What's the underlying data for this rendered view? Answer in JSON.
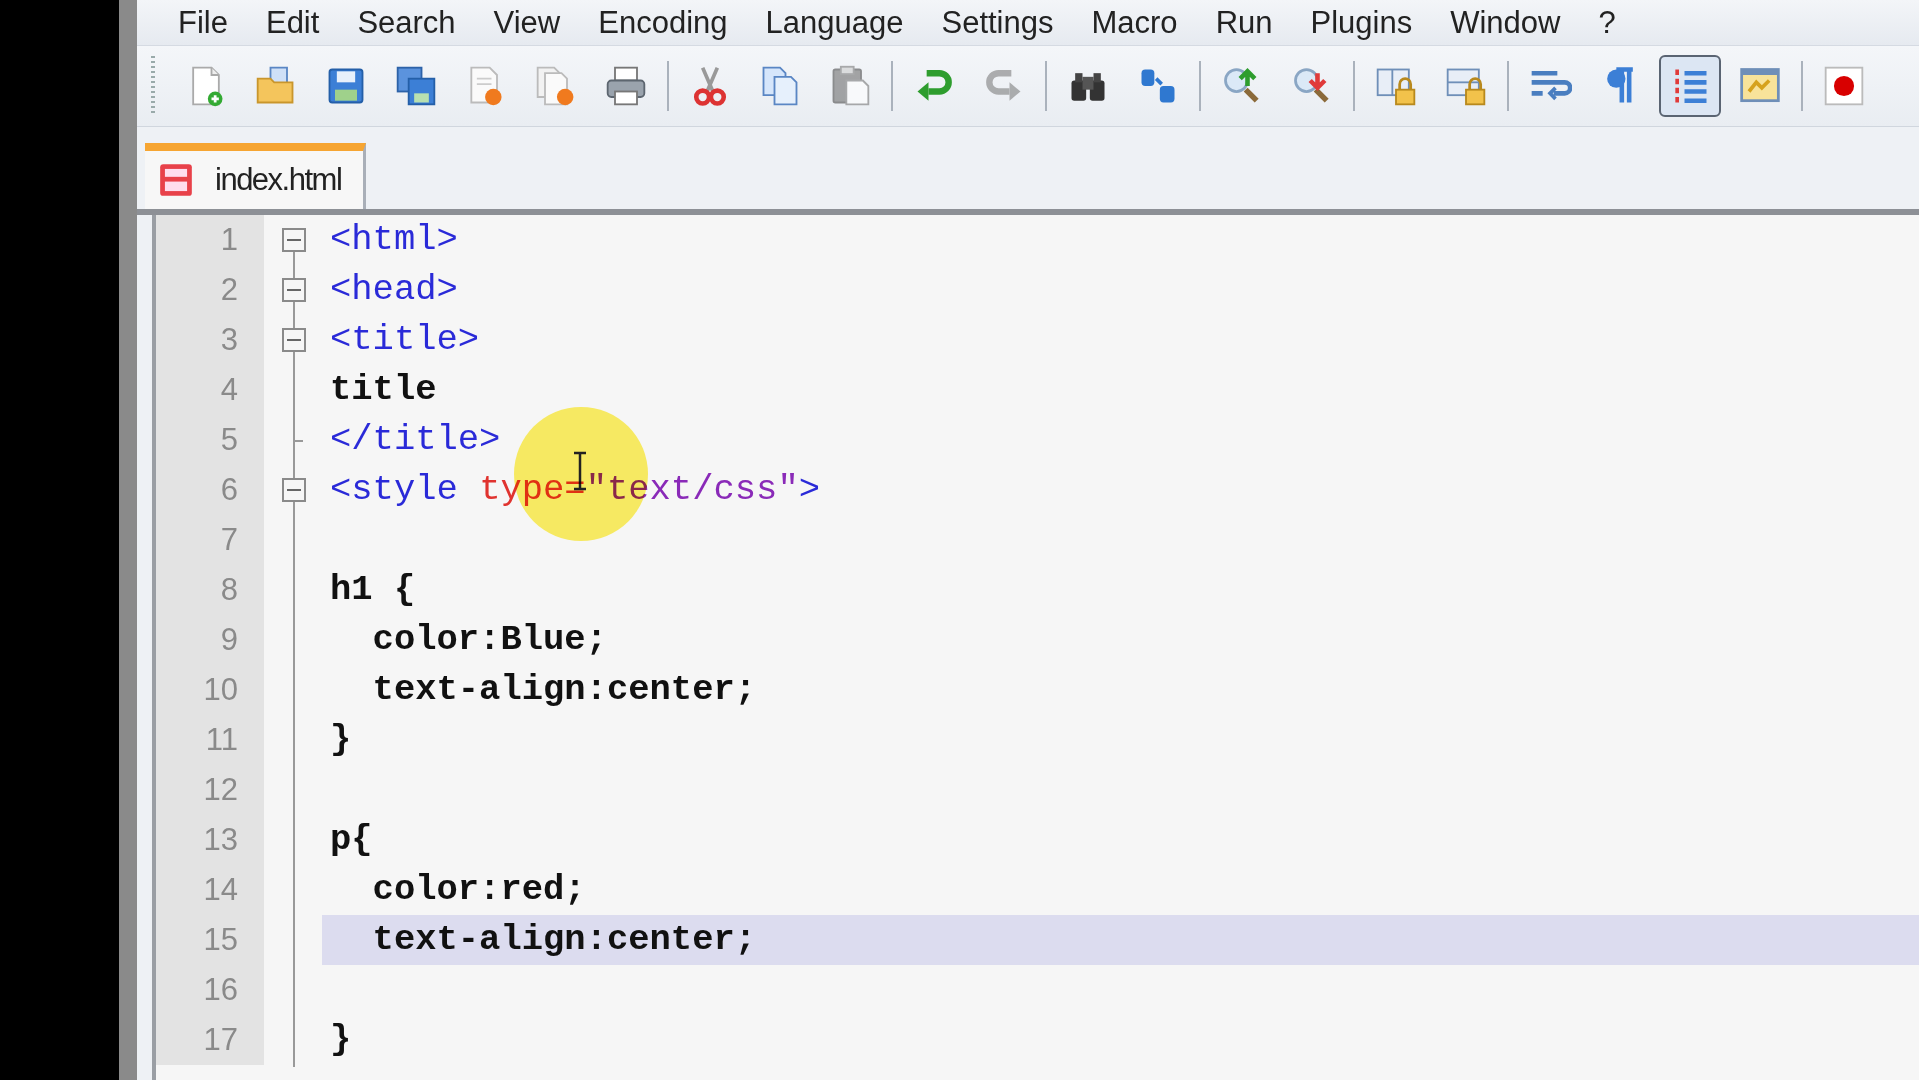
{
  "menu": [
    "File",
    "Edit",
    "Search",
    "View",
    "Encoding",
    "Language",
    "Settings",
    "Macro",
    "Run",
    "Plugins",
    "Window",
    "?"
  ],
  "toolbar": [
    {
      "kind": "new",
      "disabled": false,
      "pressed": false
    },
    {
      "kind": "open",
      "disabled": false,
      "pressed": false
    },
    {
      "kind": "save",
      "disabled": false,
      "pressed": false
    },
    {
      "kind": "save-all",
      "disabled": false,
      "pressed": false
    },
    {
      "kind": "close",
      "disabled": false,
      "pressed": false
    },
    {
      "kind": "close-all",
      "disabled": false,
      "pressed": false
    },
    {
      "kind": "print",
      "disabled": false,
      "pressed": false
    },
    {
      "kind": "separator"
    },
    {
      "kind": "cut",
      "disabled": false,
      "pressed": false
    },
    {
      "kind": "copy",
      "disabled": false,
      "pressed": false
    },
    {
      "kind": "paste",
      "disabled": true,
      "pressed": false
    },
    {
      "kind": "separator"
    },
    {
      "kind": "undo",
      "disabled": false,
      "pressed": false
    },
    {
      "kind": "redo",
      "disabled": true,
      "pressed": false
    },
    {
      "kind": "separator"
    },
    {
      "kind": "find",
      "disabled": false,
      "pressed": false
    },
    {
      "kind": "replace",
      "disabled": false,
      "pressed": false
    },
    {
      "kind": "separator"
    },
    {
      "kind": "zoom-in",
      "disabled": false,
      "pressed": false
    },
    {
      "kind": "zoom-out",
      "disabled": false,
      "pressed": false
    },
    {
      "kind": "separator"
    },
    {
      "kind": "sync-v",
      "disabled": false,
      "pressed": false
    },
    {
      "kind": "sync-h",
      "disabled": false,
      "pressed": false
    },
    {
      "kind": "separator"
    },
    {
      "kind": "wrap",
      "disabled": false,
      "pressed": false
    },
    {
      "kind": "pilcrow",
      "disabled": false,
      "pressed": false
    },
    {
      "kind": "indent-guide",
      "disabled": false,
      "pressed": true
    },
    {
      "kind": "doc-map",
      "disabled": false,
      "pressed": false
    },
    {
      "kind": "separator"
    },
    {
      "kind": "record",
      "disabled": false,
      "pressed": false
    }
  ],
  "tabs": [
    {
      "label": "index.html",
      "selected": true,
      "modified": true
    }
  ],
  "editor": {
    "lines": [
      {
        "number": "1",
        "fold_start": true,
        "fold_end": false,
        "current": false,
        "tokens": [
          {
            "kind": "tag",
            "text": "<html>"
          }
        ]
      },
      {
        "number": "2",
        "fold_start": true,
        "fold_end": false,
        "current": false,
        "tokens": [
          {
            "kind": "tag",
            "text": "<head>"
          }
        ]
      },
      {
        "number": "3",
        "fold_start": true,
        "fold_end": false,
        "current": false,
        "tokens": [
          {
            "kind": "tag",
            "text": "<title>"
          }
        ]
      },
      {
        "number": "4",
        "fold_start": false,
        "fold_end": false,
        "current": false,
        "tokens": [
          {
            "kind": "text",
            "text": "title"
          }
        ]
      },
      {
        "number": "5",
        "fold_start": false,
        "fold_end": true,
        "current": false,
        "tokens": [
          {
            "kind": "tag",
            "text": "</title>"
          }
        ]
      },
      {
        "number": "6",
        "fold_start": true,
        "fold_end": false,
        "current": false,
        "tokens": [
          {
            "kind": "tag",
            "text": "<style"
          },
          {
            "kind": "attr",
            "text": " type="
          },
          {
            "kind": "value",
            "text": "\"text/css\""
          },
          {
            "kind": "tag",
            "text": ">"
          }
        ]
      },
      {
        "number": "7",
        "fold_start": false,
        "fold_end": false,
        "current": false
      },
      {
        "number": "8",
        "fold_start": false,
        "fold_end": false,
        "current": false,
        "tokens": [
          {
            "kind": "text",
            "text": "h1 {"
          }
        ]
      },
      {
        "number": "9",
        "fold_start": false,
        "fold_end": false,
        "current": false,
        "tokens": [
          {
            "kind": "text",
            "text": "  color:Blue;"
          }
        ]
      },
      {
        "number": "10",
        "fold_start": false,
        "fold_end": false,
        "current": false,
        "tokens": [
          {
            "kind": "text",
            "text": "  text-align:center;"
          }
        ]
      },
      {
        "number": "11",
        "fold_start": false,
        "fold_end": false,
        "current": false,
        "tokens": [
          {
            "kind": "text",
            "text": "}"
          }
        ]
      },
      {
        "number": "12",
        "fold_start": false,
        "fold_end": false,
        "current": false
      },
      {
        "number": "13",
        "fold_start": false,
        "fold_end": false,
        "current": false,
        "tokens": [
          {
            "kind": "text",
            "text": "p{"
          }
        ]
      },
      {
        "number": "14",
        "fold_start": false,
        "fold_end": false,
        "current": false,
        "tokens": [
          {
            "kind": "text",
            "text": "  color:red;"
          }
        ]
      },
      {
        "number": "15",
        "fold_start": false,
        "fold_end": false,
        "current": true,
        "tokens": [
          {
            "kind": "text",
            "text": "  text-align:center;"
          }
        ]
      },
      {
        "number": "16",
        "fold_start": false,
        "fold_end": false,
        "current": false
      },
      {
        "number": "17",
        "fold_start": false,
        "fold_end": false,
        "current": false,
        "tokens": [
          {
            "kind": "text",
            "text": "}"
          }
        ]
      }
    ]
  }
}
